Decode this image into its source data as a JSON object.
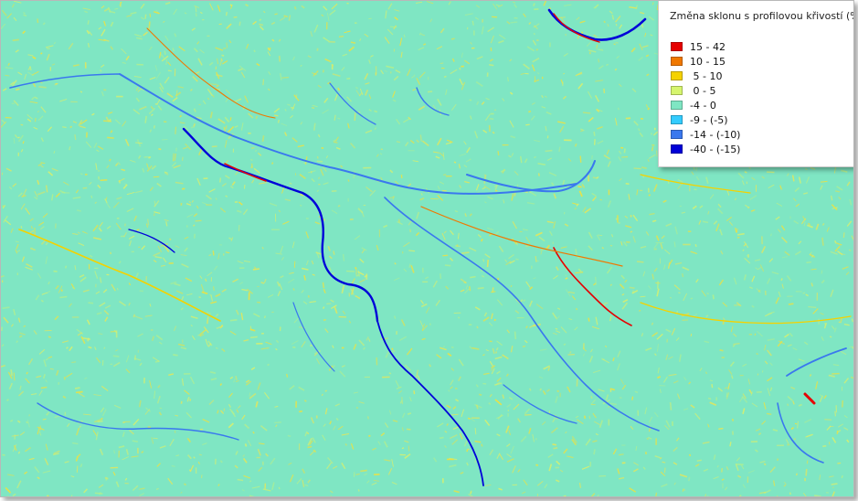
{
  "map": {
    "background_color": "#7fe6c3",
    "texture_colors": [
      "#e6e65a",
      "#f2e23c",
      "#d8f06e",
      "#b5f08c"
    ]
  },
  "legend": {
    "title": "Změna sklonu s profilovou křivostí (%)",
    "items": [
      {
        "label": "15 - 42",
        "color": "#e60000"
      },
      {
        "label": "10 - 15",
        "color": "#f07800"
      },
      {
        "label": " 5 - 10",
        "color": "#f5d200"
      },
      {
        "label": " 0 - 5",
        "color": "#d6f56e"
      },
      {
        "label": "-4 - 0",
        "color": "#7fe6c3"
      },
      {
        "label": "-9 - (-5)",
        "color": "#33ccff"
      },
      {
        "label": "-14 - (-10)",
        "color": "#3a78ee"
      },
      {
        "label": "-40 - (-15)",
        "color": "#0000d8"
      }
    ]
  }
}
